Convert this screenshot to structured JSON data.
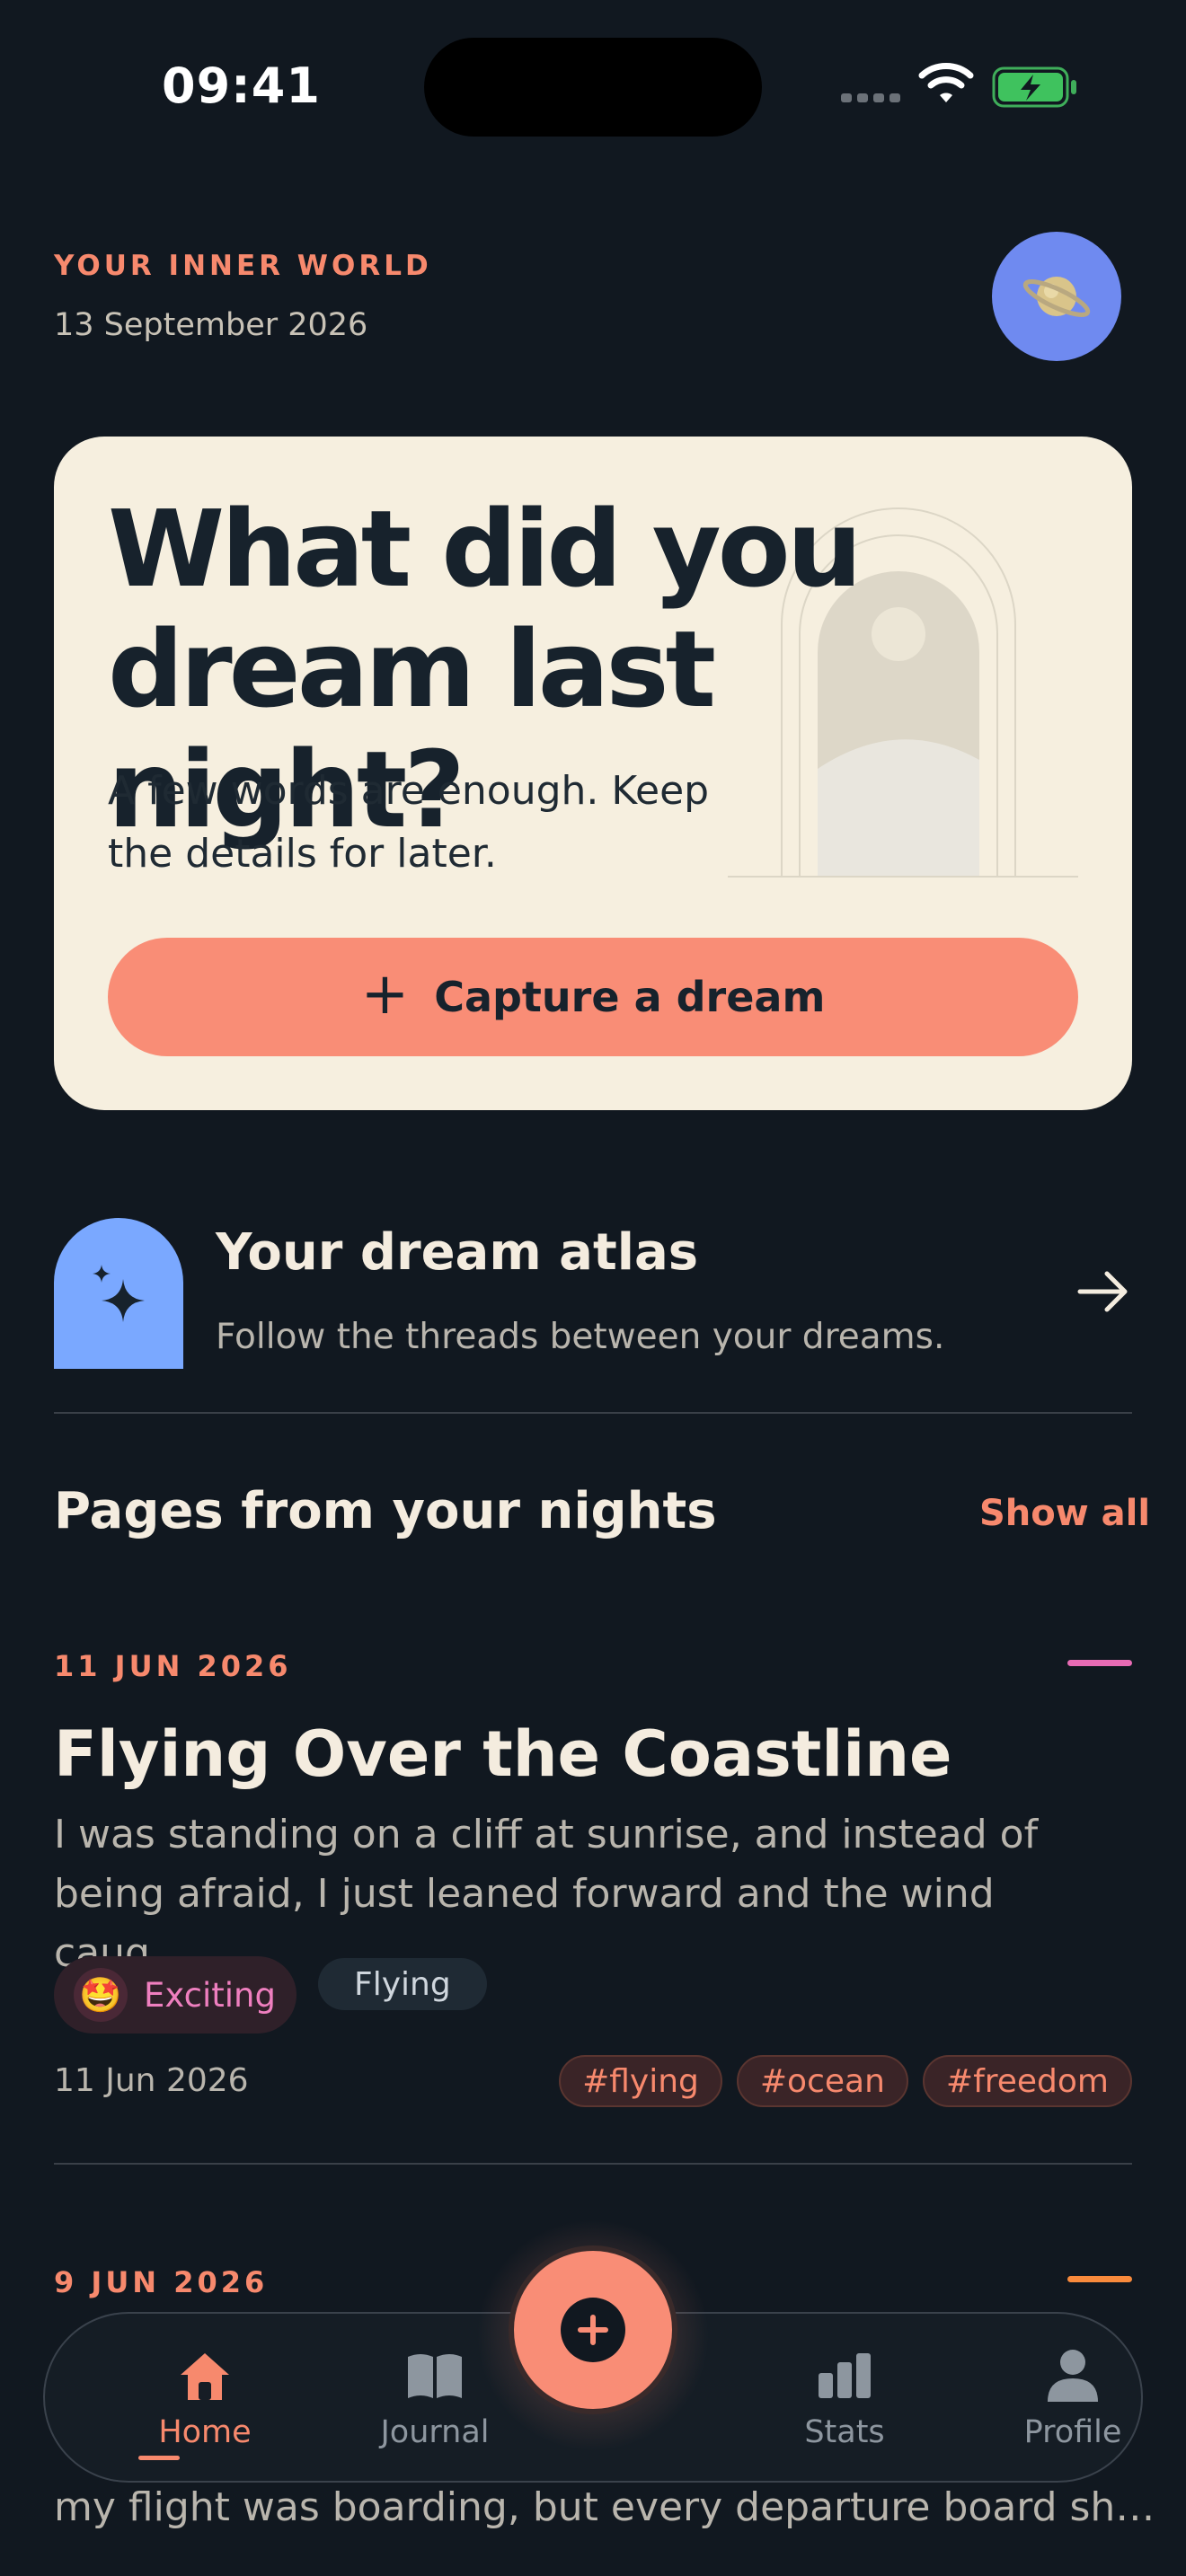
{
  "status_bar": {
    "time": "09:41"
  },
  "header": {
    "eyebrow": "YOUR INNER WORLD",
    "date": "13 September 2026",
    "avatar_icon": "planet-icon"
  },
  "hero": {
    "title": "What did you dream last night?",
    "subtitle": "A few words are enough. Keep the details for later.",
    "button_label": "Capture a dream"
  },
  "atlas": {
    "title": "Your dream atlas",
    "description": "Follow the threads between your dreams.",
    "icon": "sparkles-icon"
  },
  "section": {
    "title": "Pages from your nights",
    "show_all": "Show all"
  },
  "entries": [
    {
      "date_label": "11 JUN 2026",
      "accent": "#e86bb4",
      "title": "Flying Over the Coastline",
      "excerpt": "I was standing on a cliff at sunrise, and instead of being afraid, I just leaned forward and the wind caug…",
      "mood": {
        "emoji": "🤩",
        "label": "Exciting"
      },
      "category": "Flying",
      "date": "11 Jun 2026",
      "tags": [
        "#flying",
        "#ocean",
        "#freedom"
      ]
    },
    {
      "date_label": "9 JUN 2026",
      "accent": "#f98a3c",
      "excerpt": "my flight was boarding, but every departure board sh…"
    }
  ],
  "nav": {
    "items": [
      {
        "label": "Home",
        "icon": "home-icon"
      },
      {
        "label": "Journal",
        "icon": "book-icon"
      },
      {
        "label": "Stats",
        "icon": "bar-chart-icon"
      },
      {
        "label": "Profile",
        "icon": "person-icon"
      }
    ],
    "fab_icon": "plus-circle-icon"
  },
  "colors": {
    "background": "#111820",
    "accent": "#f98d76",
    "card": "#f6efdf"
  }
}
